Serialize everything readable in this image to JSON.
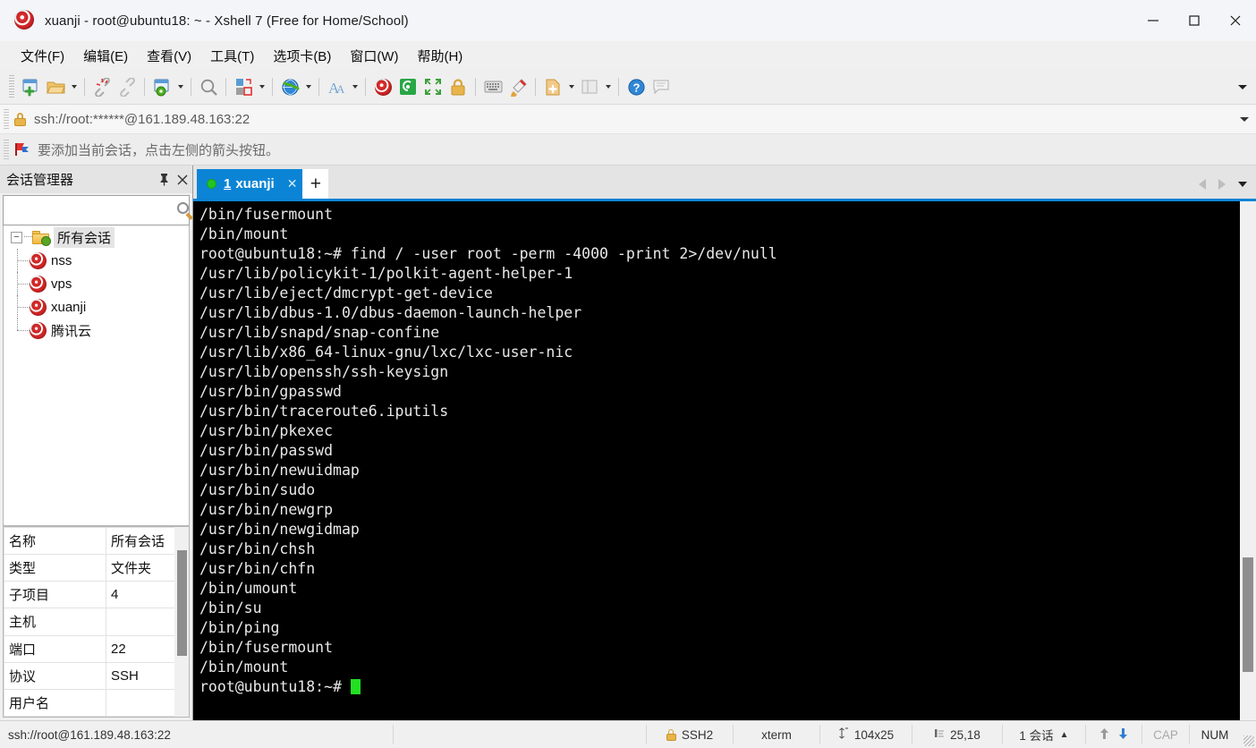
{
  "window": {
    "title": "xuanji - root@ubuntu18: ~ - Xshell 7 (Free for Home/School)",
    "app_icon": "snail-icon",
    "minimize_label": "—",
    "maximize_label": "□",
    "close_label": "✕"
  },
  "menubar": {
    "items": [
      {
        "label": "文件(F)",
        "name": "menu-file"
      },
      {
        "label": "编辑(E)",
        "name": "menu-edit"
      },
      {
        "label": "查看(V)",
        "name": "menu-view"
      },
      {
        "label": "工具(T)",
        "name": "menu-tools"
      },
      {
        "label": "选项卡(B)",
        "name": "menu-tabs"
      },
      {
        "label": "窗口(W)",
        "name": "menu-window"
      },
      {
        "label": "帮助(H)",
        "name": "menu-help"
      }
    ]
  },
  "toolbar": {
    "overflow_icon": "chevron-down-icon",
    "buttons": [
      {
        "name": "new-session-icon"
      },
      {
        "name": "open-session-icon",
        "caret": true
      },
      {
        "name": "disconnect-icon"
      },
      {
        "name": "reconnect-icon"
      },
      {
        "name": "session-properties-icon",
        "caret": true
      },
      {
        "name": "find-icon"
      },
      {
        "name": "file-transfer-icon",
        "caret": true
      },
      {
        "name": "globe-icon",
        "caret": true
      },
      {
        "name": "font-icon",
        "caret": true
      },
      {
        "name": "xshell-icon"
      },
      {
        "name": "xftp-icon"
      },
      {
        "name": "fullscreen-icon"
      },
      {
        "name": "lock-icon"
      },
      {
        "name": "keyboard-icon"
      },
      {
        "name": "highlight-icon"
      },
      {
        "name": "add-note-icon",
        "caret": true
      },
      {
        "name": "layout-icon",
        "caret": true
      },
      {
        "name": "help-icon"
      },
      {
        "name": "chat-icon"
      }
    ]
  },
  "addressbar": {
    "lock_icon": "lock-icon",
    "url": "ssh://root:******@161.189.48.163:22",
    "dropdown_icon": "chevron-down-icon"
  },
  "notice": {
    "icon": "red-flag-icon",
    "text": "要添加当前会话，点击左侧的箭头按钮。"
  },
  "session_manager": {
    "title": "会话管理器",
    "pin_icon": "pin-icon",
    "close_icon": "close-icon",
    "search": {
      "value": "",
      "placeholder": "",
      "icon": "search-icon"
    },
    "tree": {
      "root": {
        "label": "所有会话",
        "expander": "−",
        "icon": "folder-settings-icon"
      },
      "children": [
        {
          "label": "nss",
          "icon": "snail-icon"
        },
        {
          "label": "vps",
          "icon": "snail-icon"
        },
        {
          "label": "xuanji",
          "icon": "snail-icon"
        },
        {
          "label": "腾讯云",
          "icon": "snail-icon"
        }
      ]
    },
    "properties": [
      {
        "key": "名称",
        "value": "所有会话"
      },
      {
        "key": "类型",
        "value": "文件夹"
      },
      {
        "key": "子项目",
        "value": "4"
      },
      {
        "key": "主机",
        "value": ""
      },
      {
        "key": "端口",
        "value": "22"
      },
      {
        "key": "协议",
        "value": "SSH"
      },
      {
        "key": "用户名",
        "value": ""
      }
    ]
  },
  "tabs": {
    "active": {
      "number": "1",
      "name": "xuanji",
      "status_icon": "green-dot-icon",
      "close_icon": "close-icon"
    },
    "new_tab_label": "+",
    "nav": {
      "prev_icon": "chevron-left-icon",
      "next_icon": "chevron-right-icon",
      "list_icon": "chevron-down-icon"
    }
  },
  "terminal": {
    "lines": [
      "/bin/fusermount",
      "/bin/mount",
      "root@ubuntu18:~# find / -user root -perm -4000 -print 2>/dev/null",
      "/usr/lib/policykit-1/polkit-agent-helper-1",
      "/usr/lib/eject/dmcrypt-get-device",
      "/usr/lib/dbus-1.0/dbus-daemon-launch-helper",
      "/usr/lib/snapd/snap-confine",
      "/usr/lib/x86_64-linux-gnu/lxc/lxc-user-nic",
      "/usr/lib/openssh/ssh-keysign",
      "/usr/bin/gpasswd",
      "/usr/bin/traceroute6.iputils",
      "/usr/bin/pkexec",
      "/usr/bin/passwd",
      "/usr/bin/newuidmap",
      "/usr/bin/sudo",
      "/usr/bin/newgrp",
      "/usr/bin/newgidmap",
      "/usr/bin/chsh",
      "/usr/bin/chfn",
      "/bin/umount",
      "/bin/su",
      "/bin/ping",
      "/bin/fusermount",
      "/bin/mount"
    ],
    "prompt": "root@ubuntu18:~# ",
    "cursor": "block-cursor",
    "colors": {
      "background": "#000000",
      "foreground": "#e8e8e8",
      "cursor": "#22e022",
      "accent": "#0b84d6"
    }
  },
  "statusbar": {
    "connection": "ssh://root@161.189.48.163:22",
    "protocol": "SSH2",
    "protocol_icon": "lock-icon",
    "emulation": "xterm",
    "size_icon": "resize-icon",
    "size": "104x25",
    "cursor_icon": "cursor-pos-icon",
    "cursor_pos": "25,18",
    "sessions": "1 会话",
    "sessions_caret": "▲",
    "upload_icon": "arrow-up-icon",
    "download_icon": "arrow-down-icon",
    "caps": "CAP",
    "num": "NUM",
    "grip_icon": "resize-grip-icon"
  }
}
